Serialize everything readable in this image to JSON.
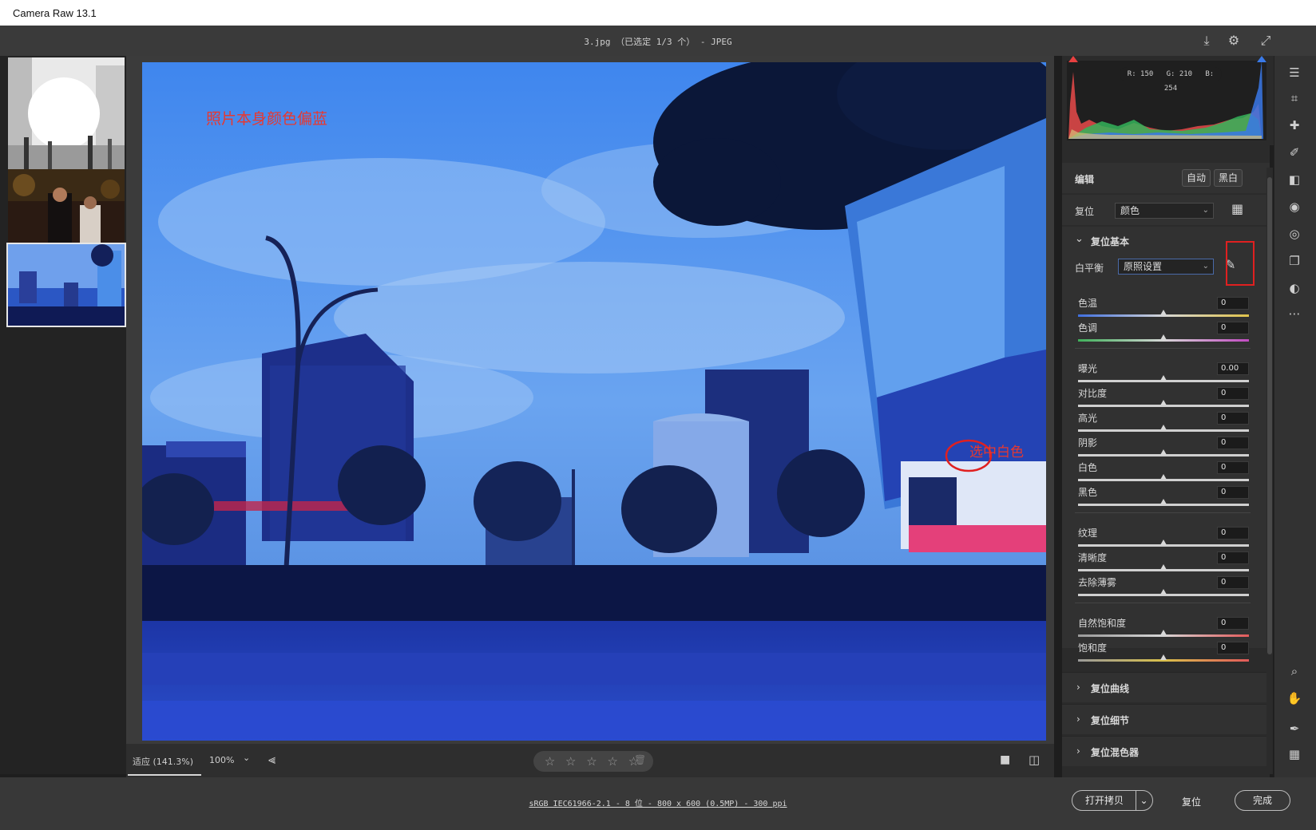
{
  "window": {
    "title": "Camera Raw 13.1"
  },
  "topbar": {
    "file_title": "3.jpg （已选定 1/3 个） -  JPEG"
  },
  "icons": {
    "save": "save-icon",
    "settings": "gear-icon",
    "fullscreen": "expand-icon"
  },
  "photo": {
    "annotation_text": "照片本身颜色偏蓝",
    "pick_label": "选中白色"
  },
  "viewbar": {
    "fit_label": "适应 (141.3%)",
    "zoom_value": "100%",
    "stars": "☆ ☆ ☆ ☆ ☆"
  },
  "histogram": {
    "r": "R: 150",
    "g": "G: 210",
    "b": "B: 254"
  },
  "edit": {
    "title": "编辑",
    "auto_button": "自动",
    "bw_button": "黑白",
    "reset_label": "复位",
    "profile_value": "颜色",
    "basic_title": "复位基本",
    "wb_label": "白平衡",
    "wb_value": "原照设置"
  },
  "sliders": [
    {
      "label": "色温",
      "value": "0"
    },
    {
      "label": "色调",
      "value": "0"
    },
    {
      "label": "曝光",
      "value": "0.00"
    },
    {
      "label": "对比度",
      "value": "0"
    },
    {
      "label": "高光",
      "value": "0"
    },
    {
      "label": "阴影",
      "value": "0"
    },
    {
      "label": "白色",
      "value": "0"
    },
    {
      "label": "黑色",
      "value": "0"
    },
    {
      "label": "纹理",
      "value": "0"
    },
    {
      "label": "清晰度",
      "value": "0"
    },
    {
      "label": "去除薄雾",
      "value": "0"
    },
    {
      "label": "自然饱和度",
      "value": "0"
    },
    {
      "label": "饱和度",
      "value": "0"
    }
  ],
  "collapsed_sections": [
    "复位曲线",
    "复位细节",
    "复位混色器"
  ],
  "bottom": {
    "file_info": "sRGB IEC61966-2.1 - 8 位 - 800 x 600 (0.5MP) - 300 ppi",
    "open_copy": "打开拷贝",
    "reset": "复位",
    "done": "完成"
  }
}
